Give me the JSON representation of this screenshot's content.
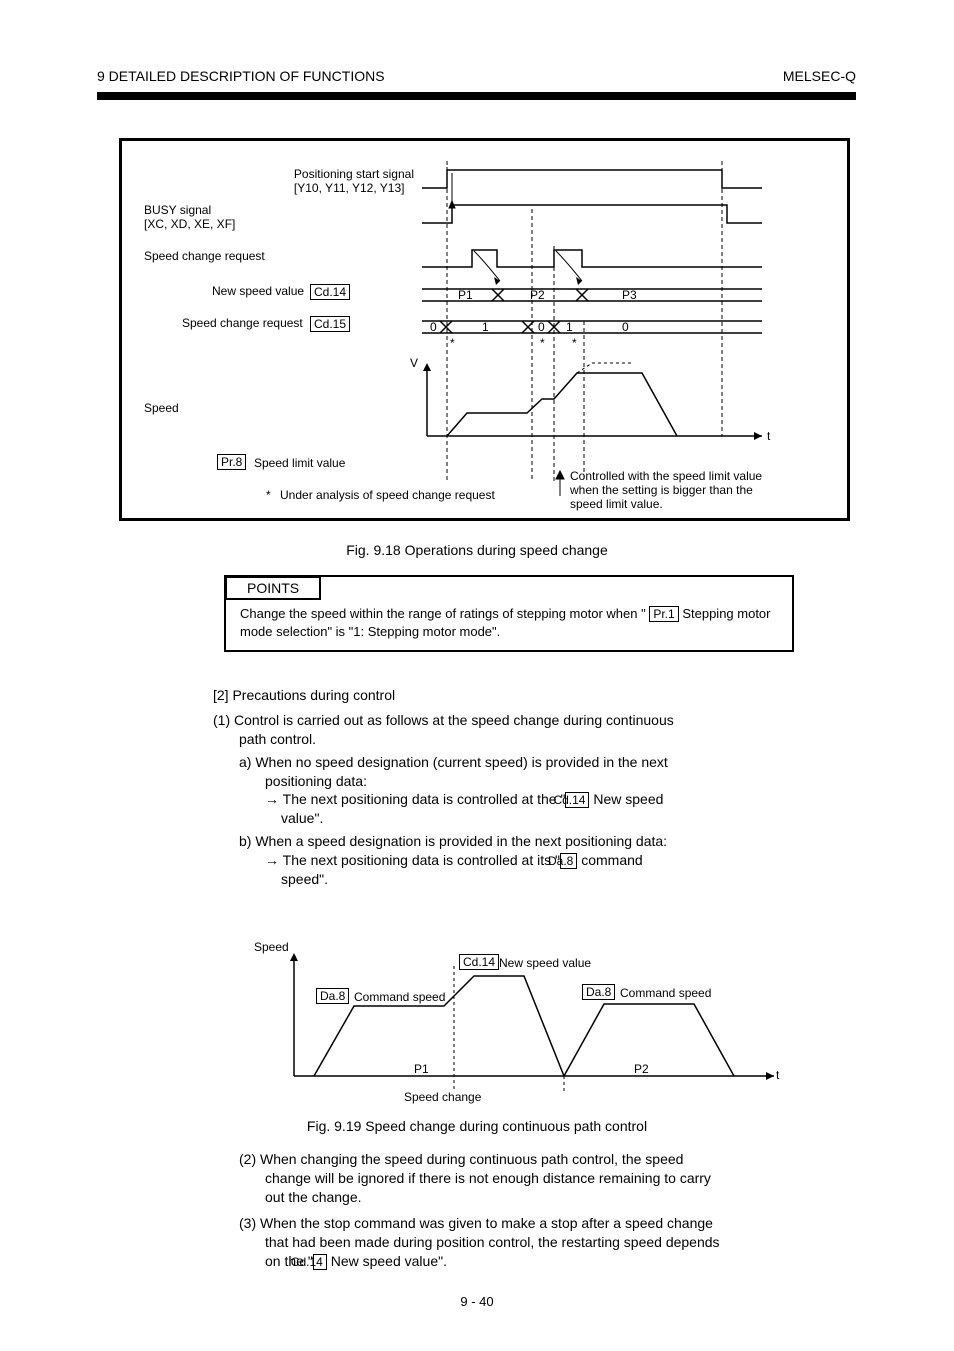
{
  "header": {
    "section": "9   DETAILED DESCRIPTION OF FUNCTIONS",
    "page_title": "MELSEC-Q"
  },
  "figure": {
    "caption": "Fig. 9.18 Operations during speed change",
    "labels": {
      "pos_start": "Positioning start signal\n[Y10, Y11, Y12, Y13]",
      "busy": "BUSY signal\n[XC, XD, XE, XF]",
      "speed_change_req": "Speed change request",
      "cd14_label_pre": "New speed value",
      "cd14_code": "Cd.14",
      "cd15_label_pre": "Speed change request",
      "cd15_code": "Cd.15",
      "speed_label": "Speed",
      "pr8_code": "Pr.8",
      "pr8_label": "Speed limit value",
      "v_axis_label": "V",
      "t_axis_label": "t",
      "speed_rows": {
        "p1": "P1",
        "p2": "P2",
        "p3": "P3"
      },
      "flag_rows": {
        "zero": "0",
        "one_a": "1",
        "zero_b": "0",
        "one_b": "1",
        "zero_c": "0"
      },
      "note_star": "Under analysis of speed change request",
      "arrow_note": "Controlled with the speed limit value\nwhen the setting is bigger than the\nspeed limit value."
    }
  },
  "point": {
    "title": "POINTS",
    "body_pre": "Change the speed within the range of ratings of stepping motor when \"",
    "pr1_code": "Pr.1",
    "body_post": "Stepping motor mode selection\" is \"1: Stepping motor mode\"."
  },
  "section2": {
    "heading": "[2]   Precautions during control",
    "items": [
      {
        "num": "(1)",
        "pre": "Control is carried out as follows at the speed change during continuous\npath control.",
        "sub": [
          {
            "roman": "a)",
            "text_pre": "When no speed designation (current speed) is provided in the next\npositioning data:",
            "arrow": "→ The next positioning data is controlled at the \"",
            "code": "Cd.14",
            "arrow_post": " New speed\nvalue\"."
          },
          {
            "roman": "b)",
            "text_pre": "When a speed designation is provided in the next positioning data:",
            "arrow": "→ The next positioning data is controlled at its \"",
            "code": "Da.8",
            "arrow_post": " command\nspeed\"."
          }
        ]
      }
    ]
  },
  "figure2": {
    "labels": {
      "speed": "Speed",
      "da8": "Da.8",
      "cd14": "Cd.14",
      "cmd_speed": "Command speed",
      "new_speed": "New speed value",
      "speed_change": "Speed change",
      "p1": "P1",
      "p2": "P2",
      "t": "t"
    },
    "caption": "Fig. 9.19 Speed change during continuous path control"
  },
  "section3": {
    "num": "(2)",
    "text_pre": "When changing the speed during continuous path control, the speed\nchange will be ignored if there is not enough distance remaining to carry\nout the change.",
    "num2": "(3)",
    "text2_pre": "When the stop command was given to make a stop after a speed change\nthat had been made during position control, the restarting speed depends\non the \"",
    "code": "Cd.14",
    "text2_post": " New speed value\"."
  },
  "footer": {
    "page": "9 - 40"
  }
}
